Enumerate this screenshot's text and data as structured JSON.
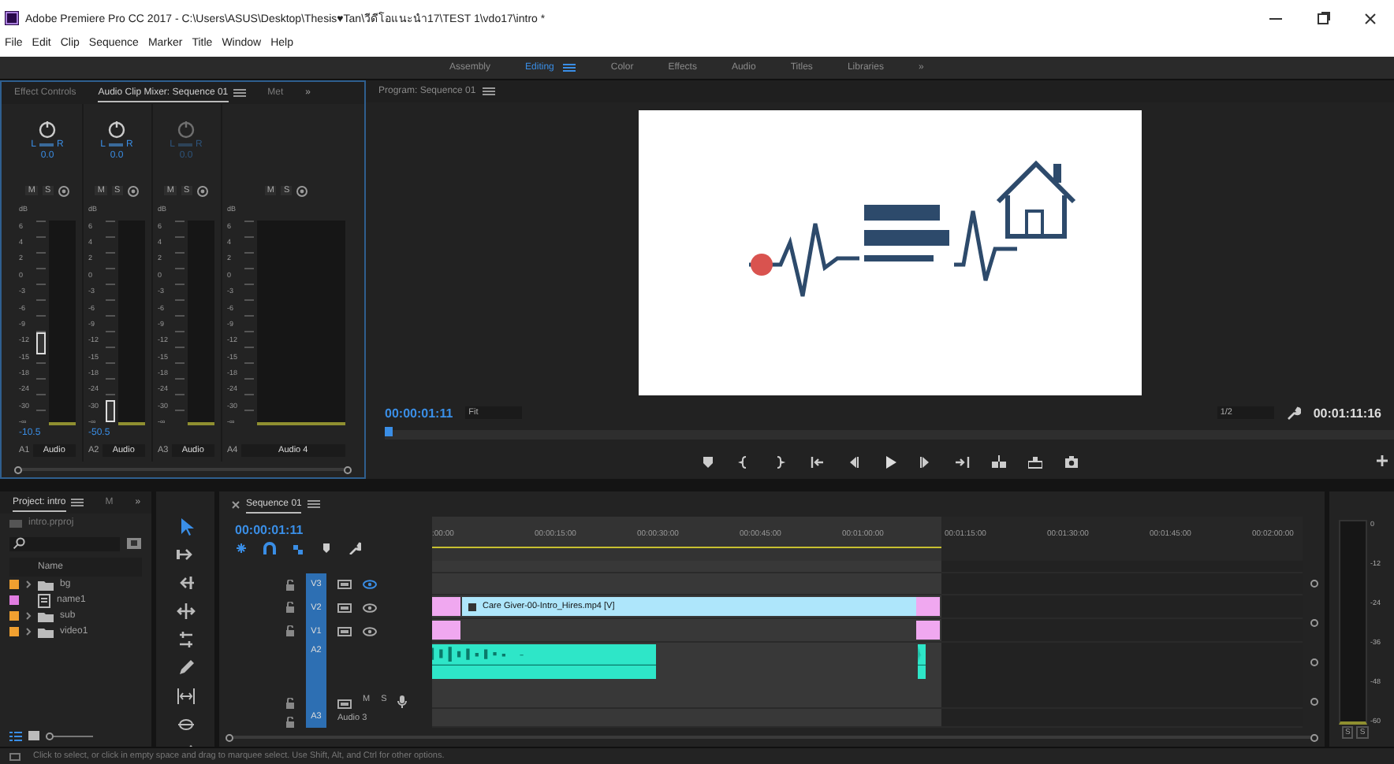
{
  "title_bar": {
    "title": "Adobe Premiere Pro CC 2017 - C:\\Users\\ASUS\\Desktop\\Thesis♥Tan\\วีดีโอแนะนำ17\\TEST 1\\vdo17\\intro *"
  },
  "menu": [
    "File",
    "Edit",
    "Clip",
    "Sequence",
    "Marker",
    "Title",
    "Window",
    "Help"
  ],
  "workspaces": [
    {
      "label": "Assembly",
      "selected": false
    },
    {
      "label": "Editing",
      "selected": true
    },
    {
      "label": "Color",
      "selected": false
    },
    {
      "label": "Effects",
      "selected": false
    },
    {
      "label": "Audio",
      "selected": false
    },
    {
      "label": "Titles",
      "selected": false
    },
    {
      "label": "Libraries",
      "selected": false
    }
  ],
  "workspaces_more": "»",
  "mixer_panel": {
    "tabs": [
      {
        "label": "Effect Controls",
        "selected": false
      },
      {
        "label": "Audio Clip Mixer: Sequence 01",
        "selected": true
      },
      {
        "label": "Met",
        "selected": false
      }
    ],
    "overflow": "»",
    "channels": [
      {
        "disabled": false,
        "pan_left": "L",
        "pan_right": "R",
        "pan": "0.0",
        "buttons": [
          "M",
          "S"
        ],
        "scale": [
          "dB",
          "6",
          "4",
          "2",
          "0",
          "-3",
          "-6",
          "-9",
          "-12",
          "-15",
          "-18",
          "-24",
          "-30",
          "-∞"
        ],
        "level": 0.38,
        "reading": "-10.5",
        "track": "A1",
        "name": "Audio"
      },
      {
        "disabled": false,
        "pan_left": "L",
        "pan_right": "R",
        "pan": "0.0",
        "buttons": [
          "M",
          "S"
        ],
        "scale": [
          "dB",
          "6",
          "4",
          "2",
          "0",
          "-3",
          "-6",
          "-9",
          "-12",
          "-15",
          "-18",
          "-24",
          "-30",
          "-∞"
        ],
        "level": 0.04,
        "reading": "-50.5",
        "track": "A2",
        "name": "Audio"
      },
      {
        "disabled": true,
        "pan_left": "L",
        "pan_right": "R",
        "pan": "0.0",
        "buttons": [
          "M",
          "S"
        ],
        "scale": [
          "dB",
          "6",
          "4",
          "2",
          "0",
          "-3",
          "-6",
          "-9",
          "-12",
          "-15",
          "-18",
          "-24",
          "-30",
          "-∞"
        ],
        "track": "A3",
        "name": "Audio"
      },
      {
        "buttons": [
          "M",
          "S"
        ],
        "scale": [
          "dB",
          "6",
          "4",
          "2",
          "0",
          "-3",
          "-6",
          "-9",
          "-12",
          "-15",
          "-18",
          "-24",
          "-30",
          "-∞"
        ],
        "track": "A4",
        "name": "Audio 4"
      }
    ]
  },
  "program_monitor": {
    "title": "Program: Sequence 01",
    "timecode": "00:00:01:11",
    "zoom": "Fit",
    "resolution": "1/2",
    "duration": "00:01:11:16"
  },
  "project_panel": {
    "tabs": [
      {
        "label": "Project: intro",
        "selected": true
      },
      {
        "label": "M",
        "selected": false
      }
    ],
    "overflow": "»",
    "file": "intro.prproj",
    "column": "Name",
    "items": [
      {
        "name": "bg",
        "kind": "bin",
        "color": "#f0a030"
      },
      {
        "name": "name1",
        "kind": "sequence",
        "color": "#e07ce0"
      },
      {
        "name": "sub",
        "kind": "bin",
        "color": "#f0a030"
      },
      {
        "name": "video1",
        "kind": "bin",
        "color": "#f0a030"
      }
    ],
    "zoom_slider": {
      "level": 0
    }
  },
  "timeline": {
    "tab": "Sequence 01",
    "timecode": "00:00:01:11",
    "ruler": [
      ":00:00",
      "00:00:15:00",
      "00:00:30:00",
      "00:00:45:00",
      "00:01:00:00",
      "00:01:15:00",
      "00:01:30:00",
      "00:01:45:00",
      "00:02:00:00"
    ],
    "tracks": [
      {
        "name": "V3",
        "kind": "video"
      },
      {
        "name": "V2",
        "kind": "video",
        "clips": [
          {
            "kind": "transition"
          },
          {
            "kind": "video",
            "name": "Care Giver-00-Intro_Hires.mp4 [V]"
          },
          {
            "kind": "transition"
          }
        ]
      },
      {
        "name": "V1",
        "kind": "video",
        "clips": [
          {
            "kind": "transition"
          },
          {
            "kind": "transition"
          }
        ]
      },
      {
        "name": "A2",
        "kind": "audio",
        "buttons": [
          "M",
          "S"
        ],
        "clips": [
          {
            "kind": "audio"
          },
          {
            "kind": "audio"
          }
        ]
      },
      {
        "name": "A3",
        "kind": "audio",
        "label": "Audio 3"
      }
    ]
  },
  "audio_meter": {
    "scale": [
      "0",
      "-12",
      "-24",
      "-36",
      "-48",
      "-60"
    ],
    "buttons": [
      "S",
      "S"
    ]
  },
  "status_bar": "Click to select, or click in empty space and drag to marquee select. Use Shift, Alt, and Ctrl for other options."
}
